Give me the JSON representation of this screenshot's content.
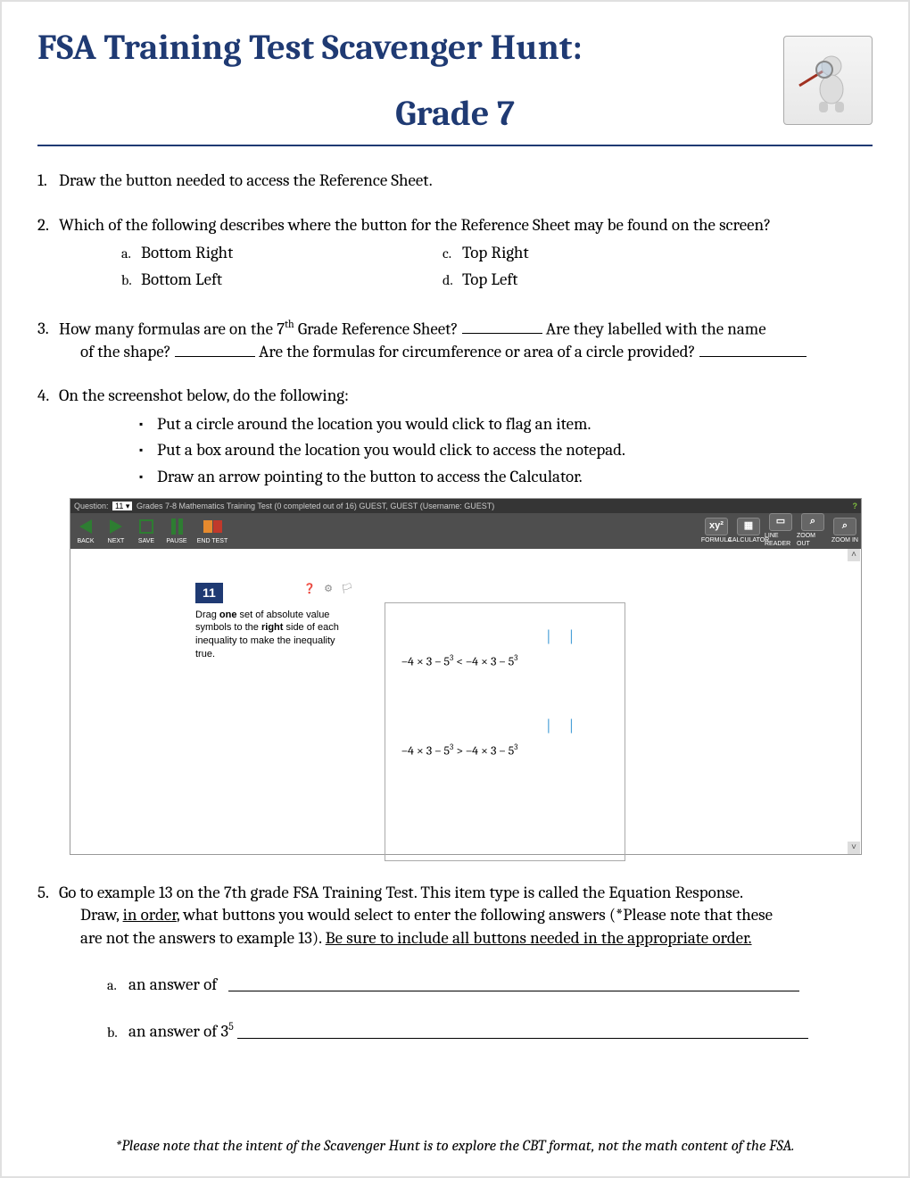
{
  "title": {
    "line1": "FSA Training Test Scavenger Hunt:",
    "line2": "Grade 7"
  },
  "q1": {
    "num": "1.",
    "text": "Draw the button needed to access the Reference Sheet."
  },
  "q2": {
    "num": "2.",
    "text": "Which of the following describes where the button for the Reference Sheet may be found on the screen?",
    "a": {
      "l": "a.",
      "t": "Bottom Right"
    },
    "b": {
      "l": "b.",
      "t": "Bottom Left"
    },
    "c": {
      "l": "c.",
      "t": "Top Right"
    },
    "d": {
      "l": "d.",
      "t": "Top Left"
    }
  },
  "q3": {
    "num": "3.",
    "part1": "How many formulas are on the 7",
    "th": "th",
    "part2": " Grade Reference Sheet?  ",
    "part3": " Are they labelled with the name",
    "line2a": "of the shape?  ",
    "line2b": " Are the formulas for circumference or area of a circle provided?  "
  },
  "q4": {
    "num": "4.",
    "text": "On the screenshot below, do the following:",
    "b1": "Put a circle around the location you would click to flag an item.",
    "b2": "Put a box around the location you would click to access the notepad.",
    "b3": "Draw an arrow pointing to the button to access the Calculator."
  },
  "shot": {
    "topbar": {
      "q": "Question:",
      "sel": "11 ▾",
      "rest": "Grades 7-8 Mathematics Training Test (0 completed out of 16)   GUEST, GUEST (Username: GUEST)"
    },
    "left": {
      "back": "BACK",
      "next": "NEXT",
      "save": "SAVE",
      "pause": "PAUSE",
      "end": "END TEST"
    },
    "right": {
      "formula": "FORMULA",
      "calc": "CALCULATOR",
      "line": "LINE READER",
      "zout": "ZOOM OUT",
      "zin": "ZOOM IN",
      "xy": "xy²",
      "calcIcon": "▦",
      "lineIcon": "▭",
      "zo": "⌕",
      "zi": "⌕"
    },
    "prompt": {
      "qn": "11",
      "icons": "❓ ⚙ 🏳",
      "l1": "Drag ",
      "l1b": "one",
      "l1c": " set of absolute value",
      "l2": "symbols to the ",
      "l2b": "right",
      "l2c": " side of each",
      "l3": "inequality to make the inequality",
      "l4": "true."
    },
    "eq": {
      "bracket": "|  |",
      "e1": "–4  ×  3  –  5",
      "sup": "3",
      "mid1": "  <  –4  ×  3  –  5",
      "mid2": "  >  –4  ×  3  –  5"
    }
  },
  "q5": {
    "num": "5.",
    "l1": "Go to example 13 on the 7th grade FSA Training Test.  This item type is called the Equation Response.",
    "l2": "Draw, ",
    "l2u": "in order",
    "l2b": ", what buttons you would select to enter the following answers (*Please note that these",
    "l3": "are not the answers to example 13).  ",
    "l3u": "Be sure to include all buttons needed in the appropriate order.",
    "a": {
      "l": "a.",
      "t": "an answer of"
    },
    "b": {
      "l": "b.",
      "t": "an answer of 3",
      "sup": "5"
    }
  },
  "footnote": "*Please note that the intent of the Scavenger Hunt is to explore the CBT format, not the math content of the FSA."
}
